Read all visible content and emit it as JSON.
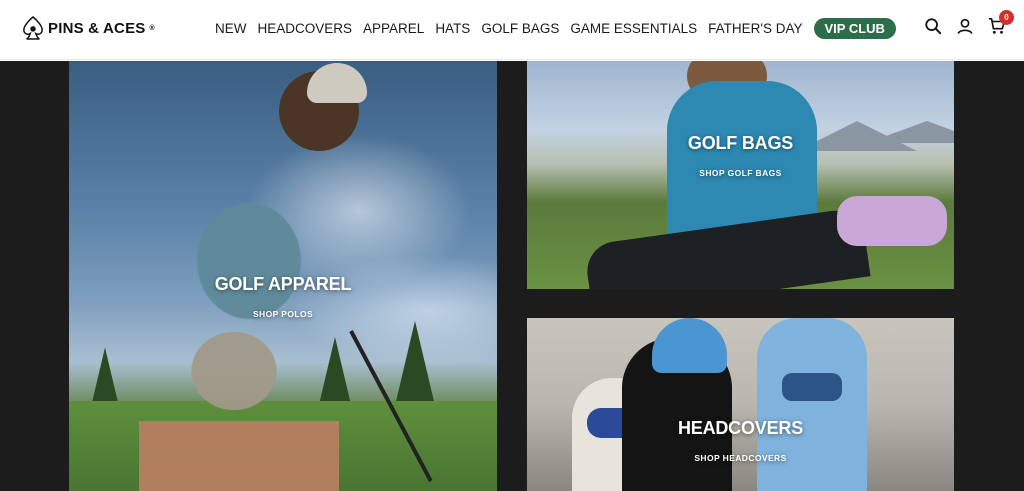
{
  "header": {
    "logo_text": "PINS & ACES",
    "logo_mark": "®",
    "nav": [
      {
        "label": "NEW"
      },
      {
        "label": "HEADCOVERS"
      },
      {
        "label": "APPAREL"
      },
      {
        "label": "HATS"
      },
      {
        "label": "GOLF BAGS"
      },
      {
        "label": "GAME ESSENTIALS"
      },
      {
        "label": "FATHER'S DAY"
      }
    ],
    "vip_label": "VIP CLUB",
    "cart_count": "0",
    "icons": [
      "search-icon",
      "account-icon",
      "cart-icon"
    ],
    "vip_color": "#2c6e49",
    "badge_color": "#d32f2f"
  },
  "tiles": {
    "apparel": {
      "title": "GOLF APPAREL",
      "link": "SHOP POLOS"
    },
    "bags": {
      "title": "GOLF BAGS",
      "link": "SHOP GOLF BAGS"
    },
    "headcovers": {
      "title": "HEADCOVERS",
      "link": "SHOP HEADCOVERS"
    }
  }
}
